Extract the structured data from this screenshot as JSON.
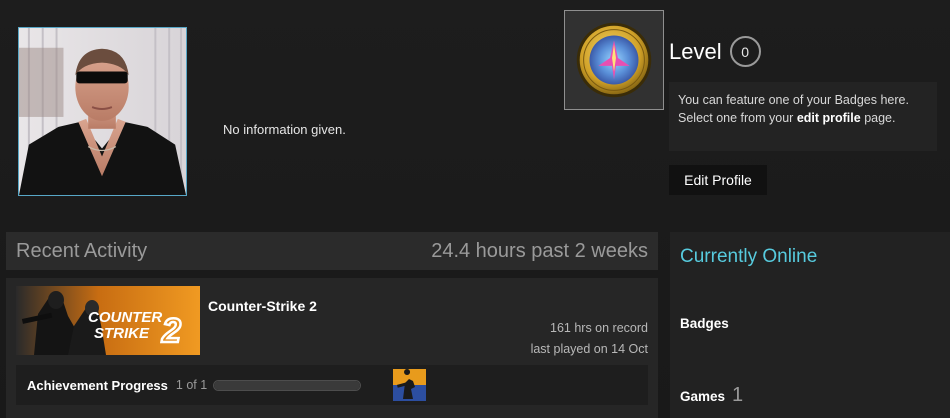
{
  "profile": {
    "summary": "No information given."
  },
  "badge": {
    "icon": "counter-strike-coin-badge"
  },
  "level": {
    "label": "Level",
    "value": "0"
  },
  "badge_info": {
    "line1": "You can feature one of your Badges here.",
    "line2_prefix": "Select one from your ",
    "line2_link": "edit profile",
    "line2_suffix": " page."
  },
  "buttons": {
    "edit_profile": "Edit Profile"
  },
  "activity": {
    "title": "Recent Activity",
    "hours_summary": "24.4 hours past 2 weeks",
    "game": {
      "name": "Counter-Strike 2",
      "hours_on_record": "161 hrs on record",
      "last_played": "last played on 14 Oct",
      "capsule_text_line1": "COUNTER",
      "capsule_text_line2": "STRIKE",
      "capsule_number": "2",
      "achievements": {
        "label": "Achievement Progress",
        "count": "1 of 1",
        "progress": 1.0
      }
    }
  },
  "sidebar": {
    "online_status": "Currently Online",
    "badges_label": "Badges",
    "games_label": "Games",
    "games_count": "1"
  },
  "colors": {
    "accent_online": "#57cbde",
    "avatar_border": "#57a7c7",
    "capsule_orange": "#e8891f"
  }
}
